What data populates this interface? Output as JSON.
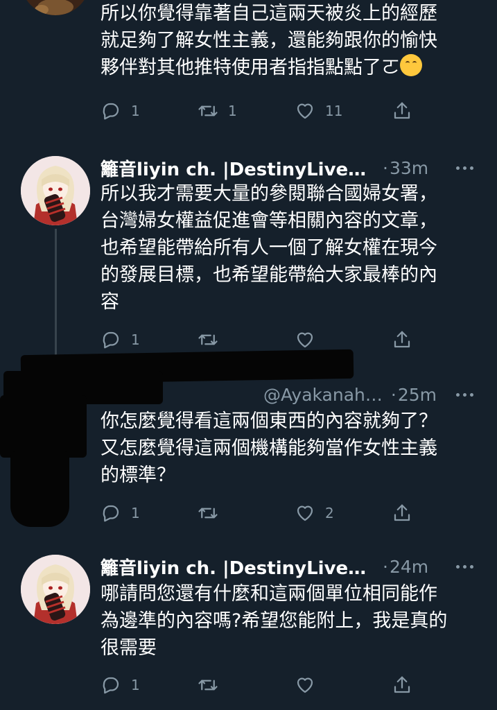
{
  "colors": {
    "background": "#15202b",
    "text": "#ffffff",
    "secondary": "#8899a6",
    "thread_line": "#38444d"
  },
  "icons": {
    "reply": "reply-icon",
    "retweet": "retweet-icon",
    "like": "heart-icon",
    "share": "share-icon",
    "more": "more-icon"
  },
  "tweets": [
    {
      "text_lines": [
        "所以你覺得靠著自己這兩天被炎上的經歷",
        "就足夠了解女性主義，還能夠跟你的愉快",
        "夥伴對其他推特使用者指指點點了ㄛ"
      ],
      "emoji": "hugging-face",
      "replies": "1",
      "retweets": "1",
      "likes": "11"
    },
    {
      "name": "籬音liyin ch. |DestinyLive所…",
      "time": "33m",
      "text_lines": [
        "所以我才需要大量的參閱聯合國婦女署，",
        "台灣婦女權益促進會等相關內容的文章，",
        "也希望能帶給所有人一個了解女權在現今",
        "的發展目標，也希望能帶給大家最棒的內",
        "容"
      ],
      "replies": "1",
      "retweets": "",
      "likes": ""
    },
    {
      "handle": "@Ayakanah…",
      "time": "25m",
      "text_lines": [
        "你怎麼覺得看這兩個東西的內容就夠了？",
        "又怎麼覺得這兩個機構能夠當作女性主義",
        "的標準？"
      ],
      "replies": "1",
      "retweets": "",
      "likes": "2"
    },
    {
      "name": "籬音liyin ch. |DestinyLive所…",
      "time": "24m",
      "text_lines": [
        "哪請問您還有什麼和這兩個單位相同能作",
        "為邊準的內容嗎?希望您能附上，我是真的",
        "很需要"
      ],
      "replies": "1",
      "retweets": "",
      "likes": ""
    }
  ]
}
